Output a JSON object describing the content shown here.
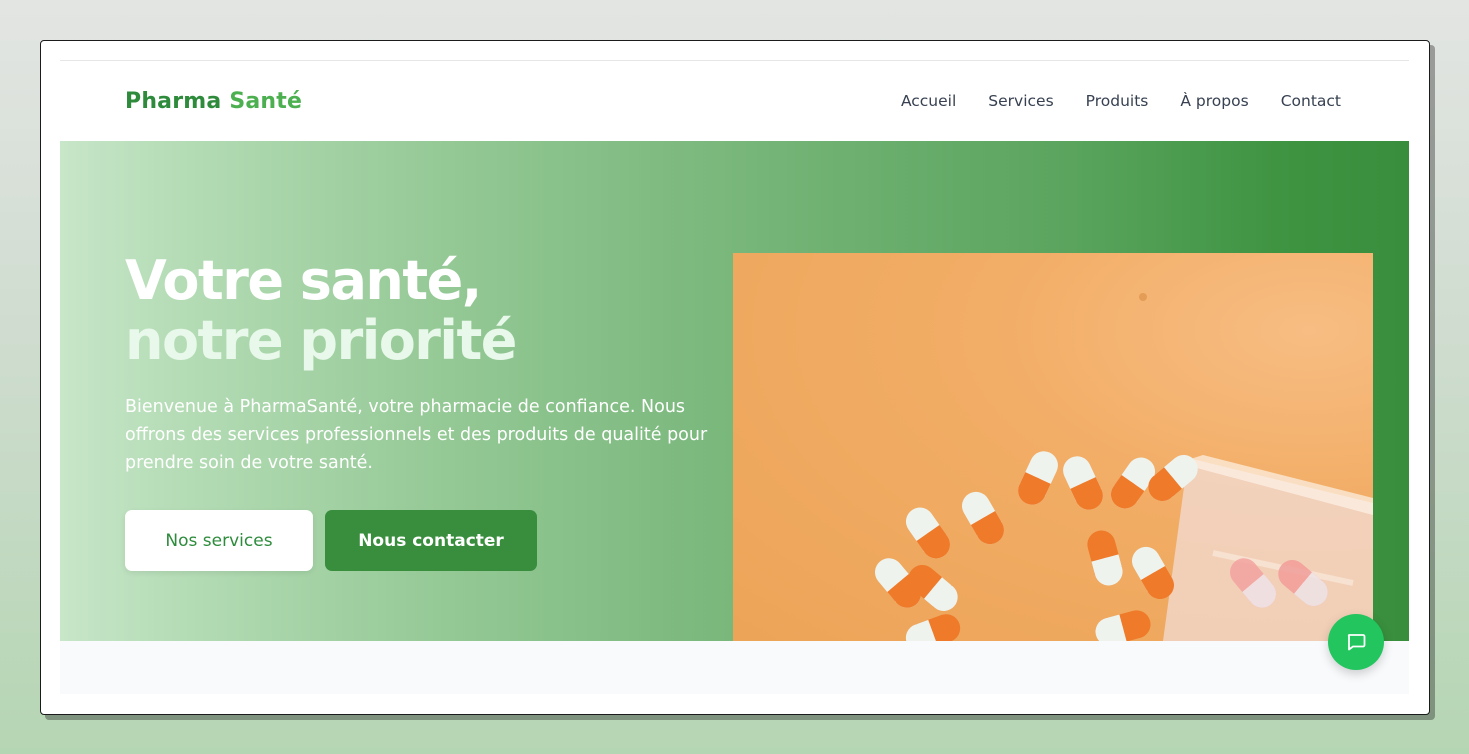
{
  "brand": {
    "part1": "Pharma",
    "part2": "Santé"
  },
  "nav": {
    "items": [
      {
        "label": "Accueil"
      },
      {
        "label": "Services"
      },
      {
        "label": "Produits"
      },
      {
        "label": "À propos"
      },
      {
        "label": "Contact"
      }
    ]
  },
  "hero": {
    "title_line1": "Votre santé,",
    "title_line2": "notre priorité",
    "description": "Bienvenue à PharmaSanté, votre pharmacie de confiance. Nous offrons des services professionnels et des produits de qualité pour prendre soin de votre santé.",
    "primary_button": "Nos services",
    "secondary_button": "Nous contacter",
    "image_alt": "Gélules orange et blanches sur fond orange"
  },
  "chat": {
    "icon": "chat-bubble-icon"
  },
  "colors": {
    "brand_dark_green": "#2e8b3c",
    "brand_green": "#4caf50",
    "button_green": "#388e3c",
    "chat_green": "#22c55e",
    "hero_orange": "#f2ad66"
  }
}
